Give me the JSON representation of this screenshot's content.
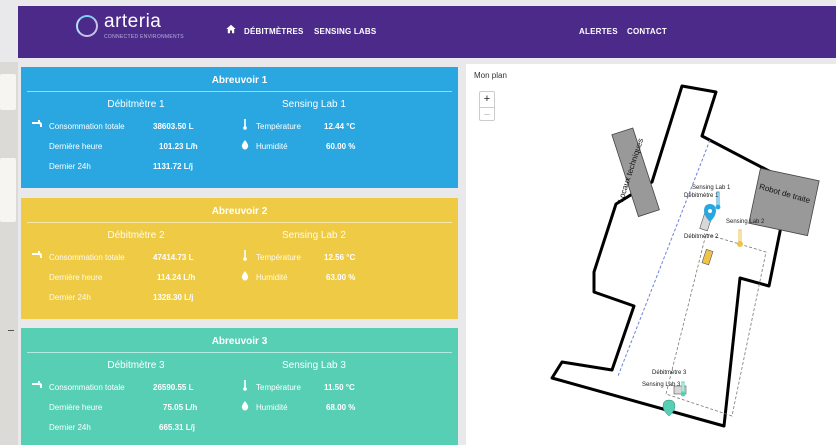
{
  "nav": {
    "logo": "arteria",
    "logo_tagline": "CONNECTED ENVIRONMENTS",
    "items": [
      "DÉBITMÈTRES",
      "SENSING LABS"
    ],
    "right_items": [
      "ALERTES",
      "CONTACT"
    ]
  },
  "cards": [
    {
      "title": "Abreuvoir 1",
      "color": "#2aa7e0",
      "flow_title": "Débitmètre 1",
      "sensor_title": "Sensing Lab 1",
      "total_label": "Consommation totale",
      "total_value": "38603.50 L",
      "hour_label": "Dernière heure",
      "hour_value": "101.23 L/h",
      "day_label": "Dernier 24h",
      "day_value": "1131.72 L/j",
      "temp_label": "Température",
      "temp_value": "12.44 °C",
      "hum_label": "Humidité",
      "hum_value": "60.00 %"
    },
    {
      "title": "Abreuvoir 2",
      "color": "#efcb45",
      "flow_title": "Débitmètre 2",
      "sensor_title": "Sensing Lab 2",
      "total_label": "Consommation totale",
      "total_value": "47414.73 L",
      "hour_label": "Dernière heure",
      "hour_value": "114.24 L/h",
      "day_label": "Dernier 24h",
      "day_value": "1328.30 L/j",
      "temp_label": "Température",
      "temp_value": "12.56 °C",
      "hum_label": "Humidité",
      "hum_value": "63.00 %"
    },
    {
      "title": "Abreuvoir 3",
      "color": "#57cfb5",
      "flow_title": "Débitmètre 3",
      "sensor_title": "Sensing Lab 3",
      "total_label": "Consommation totale",
      "total_value": "26590.55 L",
      "hour_label": "Dernière heure",
      "hour_value": "75.05 L/h",
      "day_label": "Dernier 24h",
      "day_value": "665.31 L/j",
      "temp_label": "Température",
      "temp_value": "11.50 °C",
      "hum_label": "Humidité",
      "hum_value": "68.00 %"
    }
  ],
  "map": {
    "title": "Mon plan",
    "zoom_in": "+",
    "zoom_out": "−",
    "room_locaux": "Locaux techniques",
    "room_robot": "Robot de traite",
    "labels": {
      "sl1": "Sensing Lab 1",
      "d1": "Débitmètre 1",
      "sl2": "Sensing Lab 2",
      "d2": "Débitmètre 2",
      "d3": "Débitmètre 3",
      "sl3": "Sensing Lab 3"
    }
  },
  "icons": {
    "flow": "faucet-icon",
    "temperature": "thermometer-icon",
    "humidity": "droplet-icon",
    "home": "home-icon"
  }
}
